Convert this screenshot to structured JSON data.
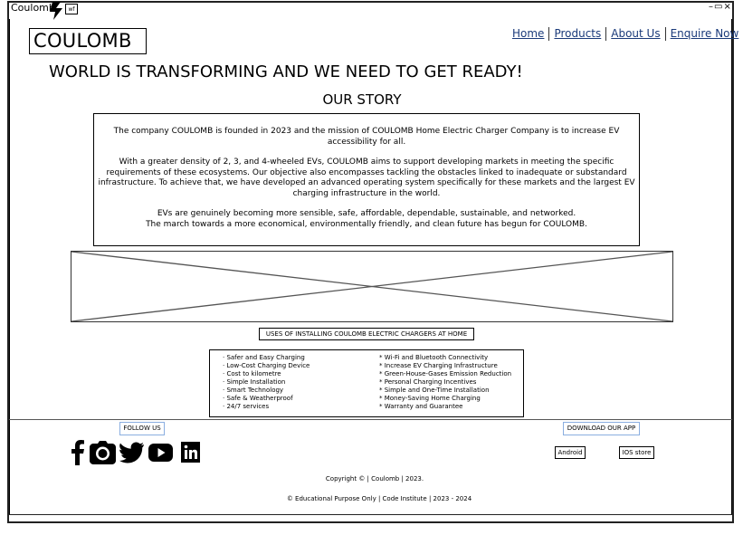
{
  "window": {
    "title": "Coulomb",
    "badge": "wf",
    "controls": "–▭×"
  },
  "header": {
    "logo": "COULOMB",
    "nav": [
      "Home",
      "Products",
      "About Us",
      "Enquire Now"
    ]
  },
  "hero": {
    "headline": "WORLD IS TRANSFORMING AND WE NEED TO GET READY!",
    "section_title": "OUR STORY"
  },
  "story": {
    "paragraphs": [
      "The company COULOMB is founded in 2023 and the mission of COULOMB Home Electric Charger Company is to increase EV accessibility for all.",
      "With a greater density of 2, 3, and 4-wheeled EVs, COULOMB aims to support developing markets in meeting the specific requirements of these ecosystems. Our objective also encompasses tackling the obstacles linked to inadequate or substandard infrastructure. To achieve that, we have developed an advanced operating system specifically for these markets and the largest EV charging infrastructure in the world.",
      "EVs are genuinely becoming more sensible, safe, affordable, dependable, sustainable, and networked.",
      "The march towards a more economical, environmentally friendly, and clean future has begun for COULOMB."
    ]
  },
  "uses": {
    "title": "USES OF INSTALLING COULOMB ELECTRIC CHARGERS AT HOME",
    "left": [
      "·  Safer and Easy Charging",
      "·  Low-Cost Charging Device",
      "·  Cost to kilometre",
      "·  Simple Installation",
      "·  Smart Technology",
      "·  Safe & Weatherproof",
      "·  24/7 services"
    ],
    "right": [
      "* Wi-Fi and Bluetooth Connectivity",
      " * Increase EV Charging Infrastructure",
      "* Green-House-Gases Emission Reduction",
      "* Personal Charging Incentives",
      "* Simple and One-Time Installation",
      "* Money-Saving Home Charging",
      " * Warranty and Guarantee"
    ]
  },
  "footer": {
    "follow_label": "FOLLOW US",
    "social_icons": [
      "facebook-icon",
      "instagram-icon",
      "twitter-icon",
      "youtube-icon",
      "linkedin-icon"
    ],
    "download_label": "DOWNLOAD OUR APP",
    "android_label": "Android",
    "ios_label": "IOS store",
    "copyright": "Copyright © | Coulomb | 2023.",
    "edu_note": "© Educational Purpose Only | Code Institute | 2023 - 2024"
  }
}
